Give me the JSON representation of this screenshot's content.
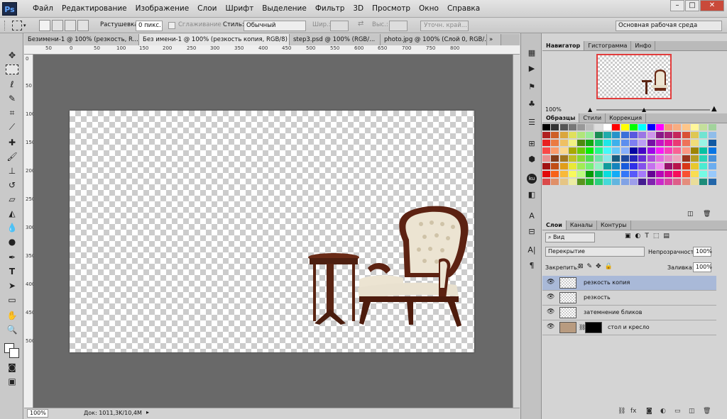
{
  "app": {
    "logo": "Ps"
  },
  "menu": [
    "Файл",
    "Редактирование",
    "Изображение",
    "Слои",
    "Шрифт",
    "Выделение",
    "Фильтр",
    "3D",
    "Просмотр",
    "Окно",
    "Справка"
  ],
  "options": {
    "feather_label": "Растушевка:",
    "feather_value": "0 пикс.",
    "antialias_label": "Сглаживание",
    "style_label": "Стиль:",
    "style_value": "Обычный",
    "width_label": "Шир.:",
    "height_label": "Выс.:",
    "refine_button": "Уточн. край...",
    "workspace": "Основная рабочая среда"
  },
  "tabs": [
    {
      "label": "Безимени-1 @ 100% (резкость, R...",
      "active": false
    },
    {
      "label": "Без имени-1 @ 100% (резкость копия, RGB/8) *",
      "active": true
    },
    {
      "label": "step3.psd @ 100% (RGB/...",
      "active": false
    },
    {
      "label": "photo.jpg @ 100% (Слой 0, RGB/...",
      "active": false
    }
  ],
  "ruler_h": [
    "50",
    "0",
    "50",
    "100",
    "150",
    "200",
    "250",
    "300",
    "350",
    "400",
    "450",
    "500",
    "550",
    "600",
    "650",
    "700",
    "750",
    "800"
  ],
  "ruler_v": [
    "0",
    "50",
    "100",
    "150",
    "200",
    "250",
    "300",
    "350",
    "400",
    "450",
    "500"
  ],
  "status": {
    "zoom": "100%",
    "doc": "Док: 1011,3K/10,4M"
  },
  "navigator": {
    "tabs": [
      "Навигатор",
      "Гистограмма",
      "Инфо"
    ],
    "zoom": "100%"
  },
  "swatches_tabs": [
    "Образцы",
    "Стили",
    "Коррекция"
  ],
  "layers_panel": {
    "tabs": [
      "Слои",
      "Каналы",
      "Контуры"
    ],
    "filter": "Вид",
    "blend": "Перекрытие",
    "opacity_label": "Непрозрачность:",
    "opacity": "100%",
    "lock_label": "Закрепить:",
    "fill_label": "Заливка:",
    "fill": "100%",
    "layers": [
      {
        "name": "резкость копия",
        "selected": true
      },
      {
        "name": "резкость",
        "selected": false
      },
      {
        "name": "затемнение бликов",
        "selected": false
      },
      {
        "name": "стол и кресло",
        "selected": false
      }
    ]
  },
  "colors": {
    "accent": "#a9b9d8",
    "workspace": "#696969",
    "nav_frame": "#e23c3c"
  }
}
